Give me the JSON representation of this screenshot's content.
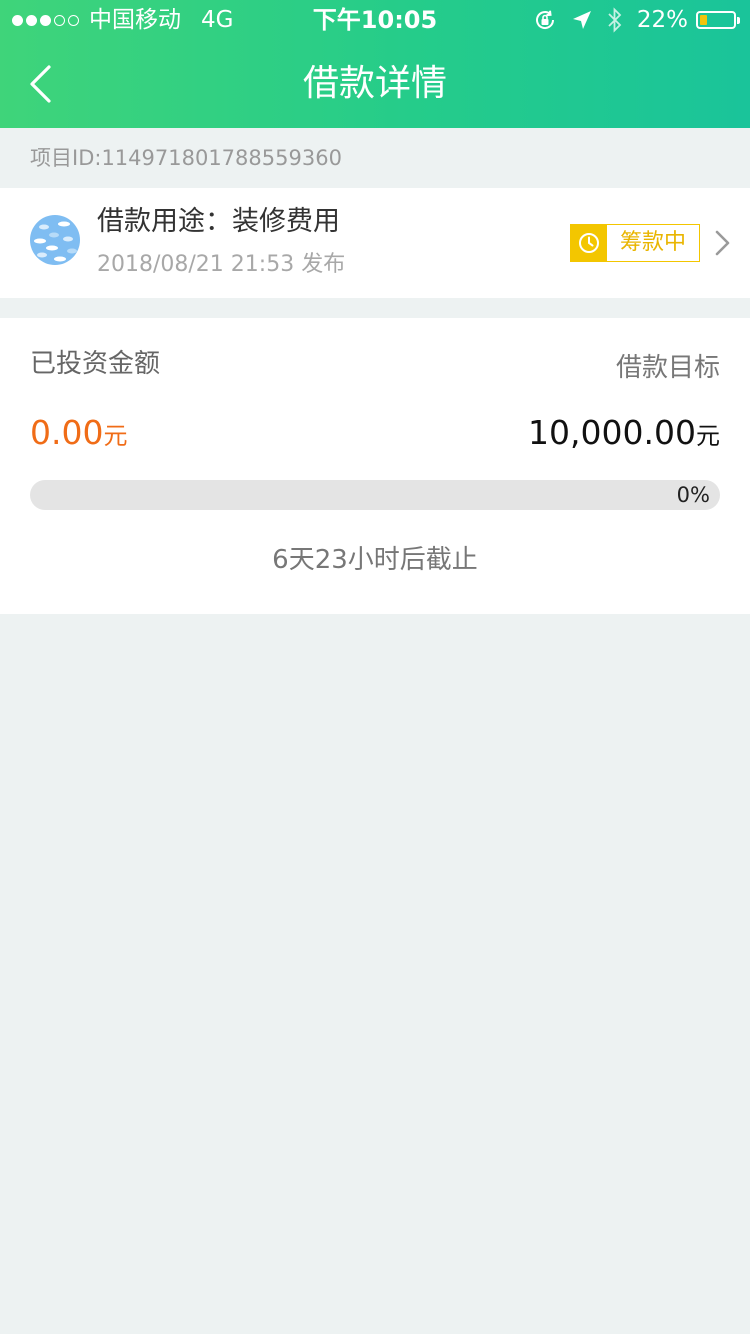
{
  "status_bar": {
    "carrier": "中国移动",
    "network": "4G",
    "time": "下午10:05",
    "battery_percent": "22%",
    "battery_level": 0.22,
    "signal_bars_filled": 3,
    "signal_bars_total": 5
  },
  "nav": {
    "back_icon": "chevron-left-icon",
    "title": "借款详情"
  },
  "project": {
    "id_text": "项目ID:114971801788559360"
  },
  "loan": {
    "purpose": "借款用途：装修费用",
    "publish_time": "2018/08/21 21:53 发布",
    "status": "筹款中",
    "status_icon": "clock-icon"
  },
  "investment": {
    "invested_label": "已投资金额",
    "invested_amount": "0.00",
    "invested_unit": "元",
    "target_label": "借款目标",
    "target_amount": "10,000.00",
    "target_unit": "元",
    "progress_text": "0%",
    "progress_value": 0,
    "deadline": "6天23小时后截止"
  },
  "colors": {
    "header_gradient_start": "#3fd47a",
    "header_gradient_end": "#1ac49a",
    "accent_orange": "#f06c17",
    "status_yellow": "#f3c600",
    "page_background": "#edf2f2"
  }
}
